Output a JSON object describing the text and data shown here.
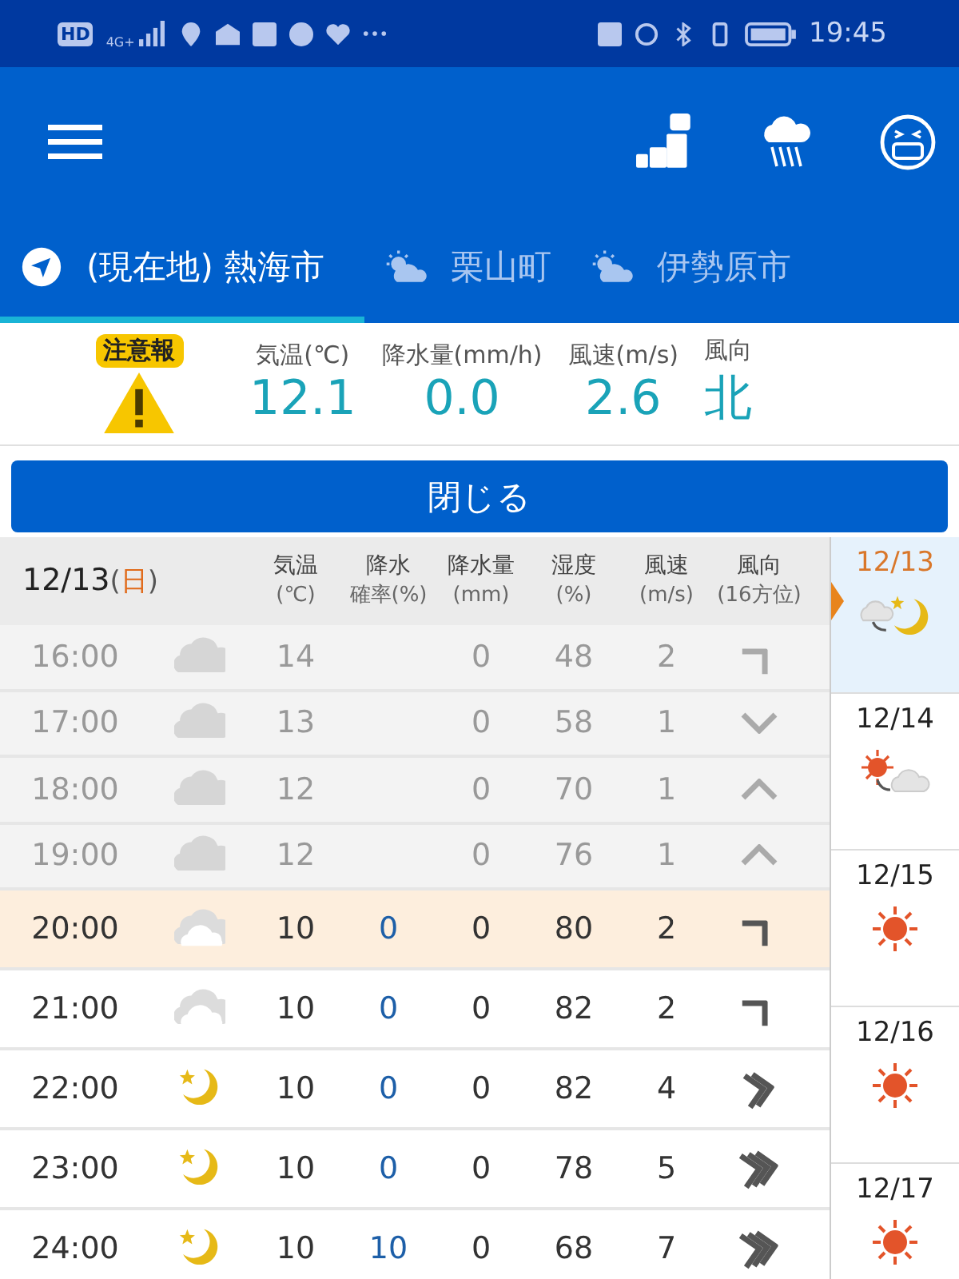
{
  "status_bar": {
    "hd": "HD",
    "network": "4G+",
    "time": "19:45"
  },
  "tabs": [
    {
      "label": "(現在地) 熱海市",
      "kind": "location",
      "selected": true
    },
    {
      "label": "栗山町",
      "kind": "weather",
      "selected": false
    },
    {
      "label": "伊勢原市",
      "kind": "weather",
      "selected": false
    }
  ],
  "current": {
    "alert": "注意報",
    "items": [
      {
        "label": "気温(℃)",
        "value": "12.1"
      },
      {
        "label": "降水量(mm/h)",
        "value": "0.0"
      },
      {
        "label": "風速(m/s)",
        "value": "2.6"
      },
      {
        "label": "風向",
        "value": "北"
      }
    ]
  },
  "close_button": "閉じる",
  "table": {
    "date": "12/13",
    "weekday": {
      "open": "(",
      "day": "日",
      "close": ")"
    },
    "columns": [
      [
        "気温",
        "(℃)"
      ],
      [
        "降水",
        "確率(%)"
      ],
      [
        "降水量",
        "(mm)"
      ],
      [
        "湿度",
        "(%)"
      ],
      [
        "風速",
        "(m/s)"
      ],
      [
        "風向",
        "(16方位)"
      ]
    ],
    "rows": [
      {
        "time": "16:00",
        "kind": "past",
        "weather": {
          "kind": "cloud"
        },
        "temp": "14",
        "amount": "0",
        "humidity": "48",
        "speed": "2",
        "wind_arrow": {
          "kind": "single_ne"
        }
      },
      {
        "time": "17:00",
        "kind": "past",
        "weather": {
          "kind": "cloud"
        },
        "temp": "13",
        "amount": "0",
        "humidity": "58",
        "speed": "1",
        "wind_arrow": {
          "kind": "single_s"
        }
      },
      {
        "time": "18:00",
        "kind": "past",
        "weather": {
          "kind": "cloud"
        },
        "temp": "12",
        "amount": "0",
        "humidity": "70",
        "speed": "1",
        "wind_arrow": {
          "kind": "single_n"
        }
      },
      {
        "time": "19:00",
        "kind": "past",
        "weather": {
          "kind": "cloud"
        },
        "temp": "12",
        "amount": "0",
        "humidity": "76",
        "speed": "1",
        "wind_arrow": {
          "kind": "single_n"
        }
      },
      {
        "time": "20:00",
        "kind": "current",
        "weather": {
          "kind": "cloud"
        },
        "temp": "10",
        "prob": "0",
        "amount": "0",
        "humidity": "80",
        "speed": "2",
        "wind_arrow": {
          "kind": "single_ne"
        }
      },
      {
        "time": "21:00",
        "kind": "future",
        "weather": {
          "kind": "cloud"
        },
        "temp": "10",
        "prob": "0",
        "amount": "0",
        "humidity": "82",
        "speed": "2",
        "wind_arrow": {
          "kind": "single_ne"
        }
      },
      {
        "time": "22:00",
        "kind": "future",
        "weather": {
          "kind": "moon"
        },
        "temp": "10",
        "prob": "0",
        "amount": "0",
        "humidity": "82",
        "speed": "4",
        "wind_arrow": {
          "kind": "double_e"
        }
      },
      {
        "time": "23:00",
        "kind": "future",
        "weather": {
          "kind": "moon"
        },
        "temp": "10",
        "prob": "0",
        "amount": "0",
        "humidity": "78",
        "speed": "5",
        "wind_arrow": {
          "kind": "triple_e"
        }
      },
      {
        "time": "24:00",
        "kind": "future",
        "weather": {
          "kind": "moon"
        },
        "temp": "10",
        "prob": "10",
        "amount": "0",
        "humidity": "68",
        "speed": "7",
        "wind_arrow": {
          "kind": "triple_e"
        }
      }
    ]
  },
  "days": [
    {
      "date": "12/13",
      "weather": {
        "kind": "cloud_to_moon"
      },
      "selected": true
    },
    {
      "date": "12/14",
      "weather": {
        "kind": "sun_to_cloud"
      },
      "selected": false
    },
    {
      "date": "12/15",
      "weather": {
        "kind": "sun"
      },
      "selected": false
    },
    {
      "date": "12/16",
      "weather": {
        "kind": "sun"
      },
      "selected": false
    },
    {
      "date": "12/17",
      "weather": {
        "kind": "sun"
      },
      "selected": false
    }
  ]
}
